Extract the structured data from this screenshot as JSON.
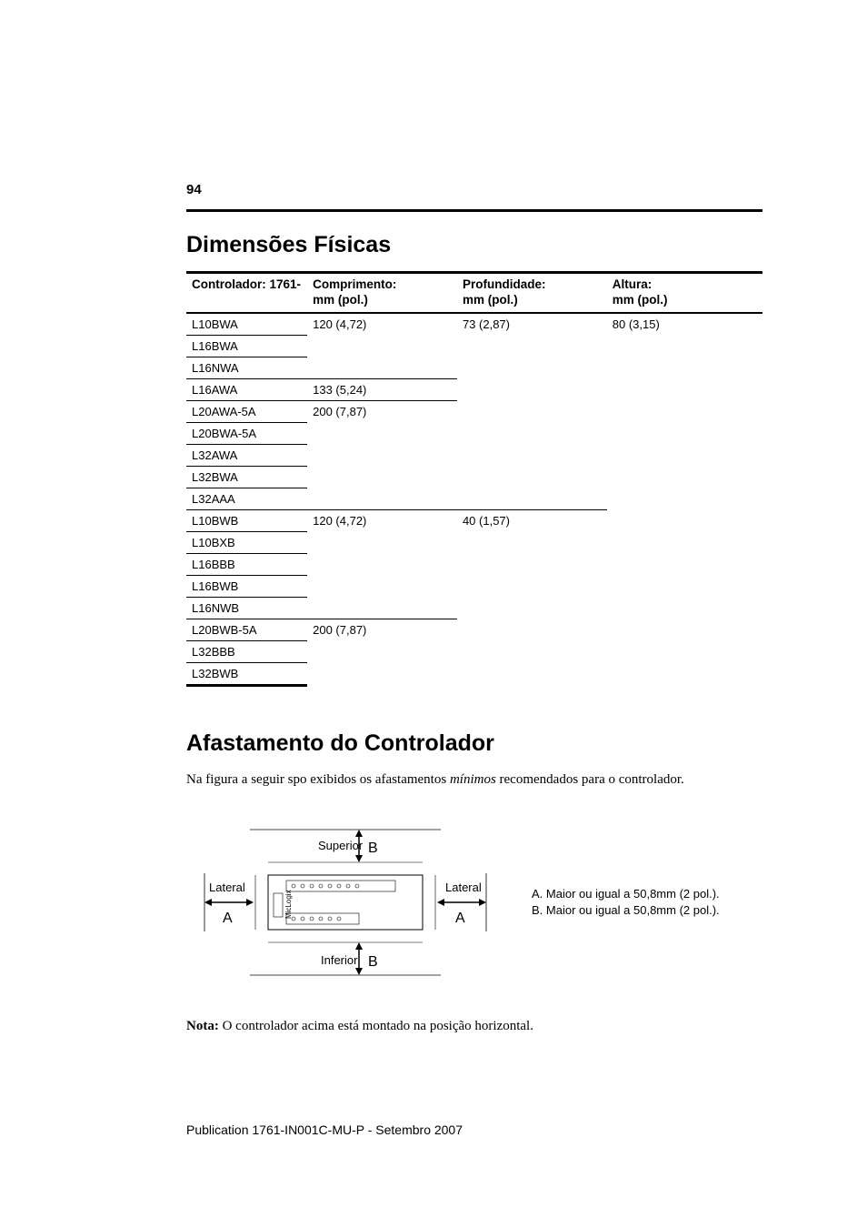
{
  "page_number": "94",
  "heading1": "Dimensões Físicas",
  "table_headers": {
    "c1": "Controlador: 1761-",
    "c2a": "Comprimento:",
    "c2b": "mm (pol.)",
    "c3a": "Profundidade:",
    "c3b": "mm (pol.)",
    "c4a": "Altura:",
    "c4b": "mm (pol.)"
  },
  "rows": {
    "r0": {
      "ctrl": "L10BWA",
      "comp": "120 (4,72)",
      "prof": "73 (2,87)",
      "alt": "80 (3,15)"
    },
    "r1": {
      "ctrl": "L16BWA"
    },
    "r2": {
      "ctrl": "L16NWA"
    },
    "r3": {
      "ctrl": "L16AWA",
      "comp": "133 (5,24)"
    },
    "r4": {
      "ctrl": "L20AWA-5A",
      "comp": "200 (7,87)"
    },
    "r5": {
      "ctrl": "L20BWA-5A"
    },
    "r6": {
      "ctrl": "L32AWA"
    },
    "r7": {
      "ctrl": "L32BWA"
    },
    "r8": {
      "ctrl": "L32AAA"
    },
    "r9": {
      "ctrl": "L10BWB",
      "comp": "120 (4,72)",
      "prof": "40 (1,57)"
    },
    "r10": {
      "ctrl": "L10BXB"
    },
    "r11": {
      "ctrl": "L16BBB"
    },
    "r12": {
      "ctrl": "L16BWB"
    },
    "r13": {
      "ctrl": "L16NWB"
    },
    "r14": {
      "ctrl": "L20BWB-5A",
      "comp": "200 (7,87)"
    },
    "r15": {
      "ctrl": "L32BBB"
    },
    "r16": {
      "ctrl": "L32BWB"
    }
  },
  "heading2": "Afastamento do Controlador",
  "body1a": "Na figura a seguir spo exibidos os afastamentos ",
  "body1b": "mínimos",
  "body1c": " recomendados para o controlador.",
  "fig": {
    "superior": "Superior",
    "inferior": "Inferior",
    "lateral": "Lateral",
    "A": "A",
    "B": "B",
    "legendA": "A. Maior ou igual a 50,8mm (2 pol.).",
    "legendB": "B. Maior ou igual a 50,8mm (2 pol.)."
  },
  "note_bold": "Nota:",
  "note_rest": " O controlador acima está montado na posição horizontal.",
  "publication": "Publication 1761-IN001C-MU-P - Setembro 2007"
}
